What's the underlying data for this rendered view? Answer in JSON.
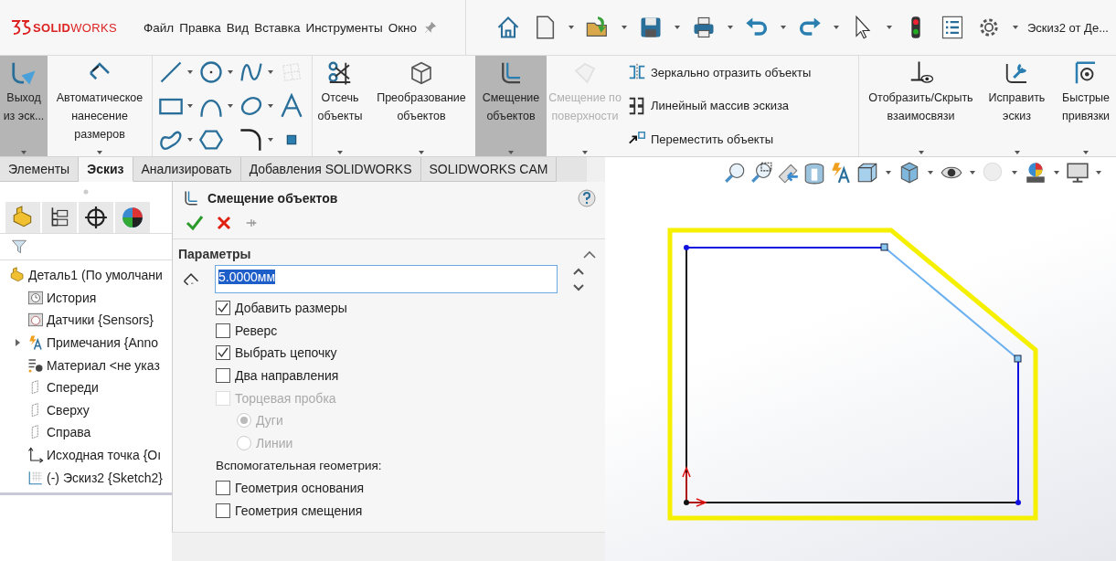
{
  "app": {
    "logo": "**SOLID**WORKS",
    "document_title": "Эскиз2 от Де..."
  },
  "menu": [
    "Файл",
    "Правка",
    "Вид",
    "Вставка",
    "Инструменты",
    "Окно"
  ],
  "ribbon": [
    {
      "kind": "large",
      "label": "Выход из эск...",
      "selected": true,
      "disabled": false
    },
    {
      "kind": "large",
      "label": "Автоматическое нанесение размеров",
      "selected": false,
      "disabled": false
    },
    {
      "kind": "sketch_tools"
    },
    {
      "kind": "large",
      "label": "Отсечь объекты",
      "selected": false,
      "disabled": false
    },
    {
      "kind": "large",
      "label": "Преобразование объектов",
      "selected": false,
      "disabled": false
    },
    {
      "kind": "large",
      "label": "Смещение объектов",
      "selected": true,
      "disabled": false
    },
    {
      "kind": "large",
      "label": "Смещение по поверхности",
      "selected": false,
      "disabled": true
    },
    {
      "kind": "list",
      "items": [
        "Зеркально отразить объекты",
        "Линейный массив эскиза",
        "Переместить объекты"
      ]
    },
    {
      "kind": "large",
      "label": "Отобразить/Скрыть взаимосвязи",
      "selected": false,
      "disabled": false
    },
    {
      "kind": "large",
      "label": "Исправить эскиз",
      "selected": false,
      "disabled": false
    },
    {
      "kind": "large",
      "label": "Быстрые привязки",
      "selected": false,
      "disabled": false
    }
  ],
  "tabs": [
    {
      "label": "Элементы",
      "selected": false
    },
    {
      "label": "Эскиз",
      "selected": true
    },
    {
      "label": "Анализировать",
      "selected": false
    },
    {
      "label": "Добавления SOLIDWORKS",
      "selected": false
    },
    {
      "label": "SOLIDWORKS CAM",
      "selected": false
    }
  ],
  "tree": {
    "label": "Деталь1 (По умолчани",
    "children": [
      {
        "label": "История",
        "collapsed": false
      },
      {
        "label": "Датчики {Sensors}",
        "collapsed": false
      },
      {
        "label": "Примечания {Anno",
        "collapsed": true
      },
      {
        "label": "Материал <не указ",
        "collapsed": false
      },
      {
        "label": "Спереди",
        "collapsed": false
      },
      {
        "label": "Сверху",
        "collapsed": false
      },
      {
        "label": "Справа",
        "collapsed": false
      },
      {
        "label": "Исходная точка {Oı",
        "collapsed": false
      },
      {
        "label": "(-) Эскиз2 {Sketch2}",
        "collapsed": false
      }
    ]
  },
  "property_manager": {
    "title": "Смещение объектов",
    "section": "Параметры",
    "distance": "5.0000мм",
    "options": [
      {
        "kind": "checkbox",
        "label": "Добавить размеры",
        "checked": true,
        "disabled": false
      },
      {
        "kind": "checkbox",
        "label": "Реверс",
        "checked": false,
        "disabled": false
      },
      {
        "kind": "checkbox",
        "label": "Выбрать цепочку",
        "checked": true,
        "disabled": false
      },
      {
        "kind": "checkbox",
        "label": "Два направления",
        "checked": false,
        "disabled": false
      },
      {
        "kind": "checkbox",
        "label": "Торцевая пробка",
        "checked": false,
        "disabled": true
      },
      {
        "kind": "radio",
        "label": "Дуги",
        "selected": true,
        "disabled": true
      },
      {
        "kind": "radio",
        "label": "Линии",
        "selected": false,
        "disabled": true
      },
      {
        "kind": "label",
        "label": "Вспомогательная геометрия:"
      },
      {
        "kind": "checkbox",
        "label": "Геометрия основания",
        "checked": false,
        "disabled": false
      },
      {
        "kind": "checkbox",
        "label": "Геометрия смещения",
        "checked": false,
        "disabled": false
      }
    ]
  }
}
